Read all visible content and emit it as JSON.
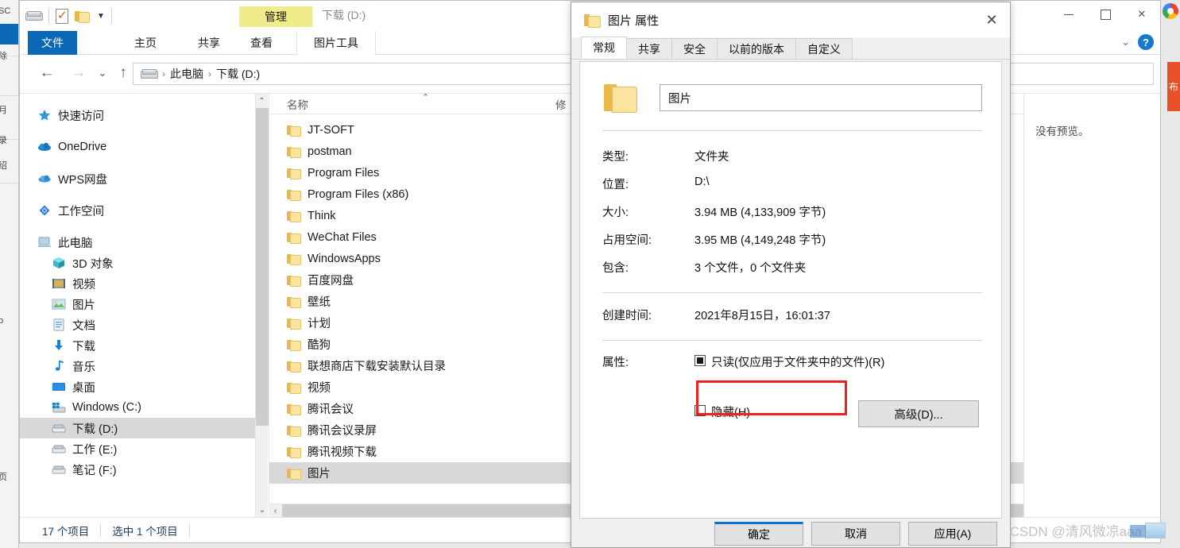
{
  "window": {
    "title": "下载 (D:)",
    "context_tab": "管理",
    "quick_access": {
      "drive_icon": "drive-icon",
      "properties_icon": "properties-icon",
      "new_folder_icon": "new-folder-icon",
      "customize_icon": "chevron-down-icon"
    },
    "controls": {
      "minimize": "minimize-icon",
      "maximize": "maximize-icon",
      "close": "close-icon"
    }
  },
  "ribbon": {
    "tabs": [
      {
        "label": "文件",
        "active": true
      },
      {
        "label": "主页",
        "active": false
      },
      {
        "label": "共享",
        "active": false
      },
      {
        "label": "查看",
        "active": false
      },
      {
        "label": "图片工具",
        "active": false
      }
    ],
    "collapse_icon": "chevron-down-icon",
    "help_label": "?"
  },
  "address": {
    "back_icon": "arrow-left-icon",
    "forward_icon": "arrow-right-icon",
    "history_icon": "chevron-down-icon",
    "up_icon": "arrow-up-icon",
    "crumbs": [
      "此电脑",
      "下载 (D:)"
    ],
    "separator": "›",
    "drive_icon": "drive-icon"
  },
  "sidebar": {
    "items": [
      {
        "label": "快速访问",
        "icon": "star-icon",
        "indent": false,
        "selected": false
      },
      {
        "label": "OneDrive",
        "icon": "cloud-icon",
        "indent": false,
        "selected": false
      },
      {
        "label": "WPS网盘",
        "icon": "cloud-icon",
        "indent": false,
        "selected": false
      },
      {
        "label": "工作空间",
        "icon": "diamond-icon",
        "indent": false,
        "selected": false
      },
      {
        "label": "此电脑",
        "icon": "computer-icon",
        "indent": false,
        "selected": false
      },
      {
        "label": "3D 对象",
        "icon": "cube-icon",
        "indent": true,
        "selected": false
      },
      {
        "label": "视频",
        "icon": "video-icon",
        "indent": true,
        "selected": false
      },
      {
        "label": "图片",
        "icon": "picture-icon",
        "indent": true,
        "selected": false
      },
      {
        "label": "文档",
        "icon": "document-icon",
        "indent": true,
        "selected": false
      },
      {
        "label": "下载",
        "icon": "download-icon",
        "indent": true,
        "selected": false
      },
      {
        "label": "音乐",
        "icon": "music-icon",
        "indent": true,
        "selected": false
      },
      {
        "label": "桌面",
        "icon": "desktop-icon",
        "indent": true,
        "selected": false
      },
      {
        "label": "Windows (C:)",
        "icon": "windows-drive-icon",
        "indent": true,
        "selected": false
      },
      {
        "label": "下载 (D:)",
        "icon": "drive-icon",
        "indent": true,
        "selected": true
      },
      {
        "label": "工作 (E:)",
        "icon": "drive-icon",
        "indent": true,
        "selected": false
      },
      {
        "label": "笔记 (F:)",
        "icon": "drive-icon",
        "indent": true,
        "selected": false
      }
    ],
    "scroll_up_icon": "chevron-up-icon",
    "scroll_down_icon": "chevron-down-icon"
  },
  "filelist": {
    "columns": [
      "名称",
      "修"
    ],
    "sort_icon": "chevron-up-icon",
    "rows": [
      {
        "name": "JT-SOFT",
        "selected": false
      },
      {
        "name": "postman",
        "selected": false
      },
      {
        "name": "Program Files",
        "selected": false
      },
      {
        "name": "Program Files (x86)",
        "selected": false
      },
      {
        "name": "Think",
        "selected": false
      },
      {
        "name": "WeChat Files",
        "selected": false
      },
      {
        "name": "WindowsApps",
        "selected": false
      },
      {
        "name": "百度网盘",
        "selected": false
      },
      {
        "name": "壁纸",
        "selected": false
      },
      {
        "name": "计划",
        "selected": false
      },
      {
        "name": "酷狗",
        "selected": false
      },
      {
        "name": "联想商店下载安装默认目录",
        "selected": false
      },
      {
        "name": "视频",
        "selected": false
      },
      {
        "name": "腾讯会议",
        "selected": false
      },
      {
        "name": "腾讯会议录屏",
        "selected": false
      },
      {
        "name": "腾讯视频下载",
        "selected": false
      },
      {
        "name": "图片",
        "selected": true
      }
    ],
    "hscroll_left_icon": "chevron-left-icon"
  },
  "preview": {
    "text": "没有预览。"
  },
  "statusbar": {
    "count": "17 个项目",
    "selection": "选中 1 个项目"
  },
  "dialog": {
    "title": "图片 属性",
    "folder_icon": "folder-icon",
    "close_icon": "close-icon",
    "tabs": [
      {
        "label": "常规",
        "active": true
      },
      {
        "label": "共享",
        "active": false
      },
      {
        "label": "安全",
        "active": false
      },
      {
        "label": "以前的版本",
        "active": false
      },
      {
        "label": "自定义",
        "active": false
      }
    ],
    "name_value": "图片",
    "fields": [
      {
        "label": "类型:",
        "value": "文件夹"
      },
      {
        "label": "位置:",
        "value": "D:\\"
      },
      {
        "label": "大小:",
        "value": "3.94 MB (4,133,909 字节)"
      },
      {
        "label": "占用空间:",
        "value": "3.95 MB (4,149,248 字节)"
      },
      {
        "label": "包含:",
        "value": "3 个文件，0 个文件夹"
      }
    ],
    "created_label": "创建时间:",
    "created_value": "2021年8月15日，16:01:37",
    "attributes_label": "属性:",
    "readonly_label": "只读(仅应用于文件夹中的文件)(R)",
    "readonly_state": "indeterminate",
    "hidden_label": "隐藏(H)",
    "hidden_state": "unchecked",
    "advanced_label": "高级(D)...",
    "buttons": [
      {
        "label": "确定",
        "default": true
      },
      {
        "label": "取消",
        "default": false
      },
      {
        "label": "应用(A)",
        "default": false
      }
    ]
  },
  "watermark": {
    "text": "CSDN @清风微凉aaa"
  },
  "colors": {
    "accent": "#0a68b5",
    "context_tab": "#f0ec8b",
    "annotation_red": "#ef2222",
    "selection_gray": "#d8d8d8"
  }
}
